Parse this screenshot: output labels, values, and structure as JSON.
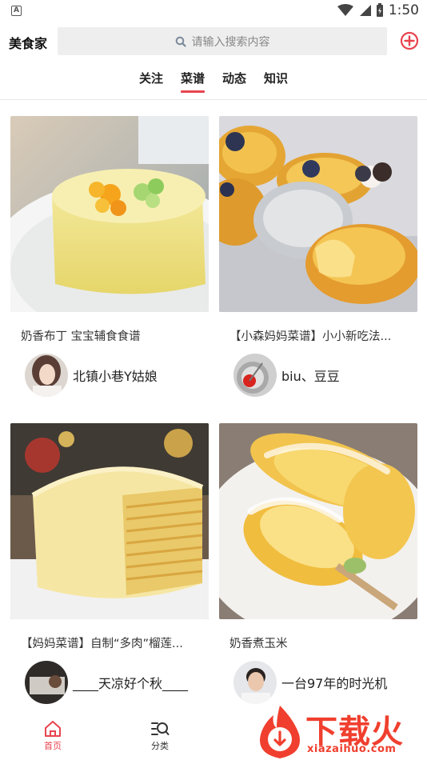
{
  "status_bar": {
    "time": "1:50",
    "badge": "A"
  },
  "header": {
    "app_name": "美食家",
    "search_placeholder": "请输入搜索内容"
  },
  "tabs": [
    {
      "label": "关注",
      "active": false
    },
    {
      "label": "菜谱",
      "active": true
    },
    {
      "label": "动态",
      "active": false
    },
    {
      "label": "知识",
      "active": false
    }
  ],
  "cards": [
    {
      "title": "奶香布丁 宝宝辅食食谱",
      "author": "北镇小巷Y姑娘"
    },
    {
      "title": "【小森妈妈菜谱】小小新吃法...",
      "author": "biu、豆豆"
    },
    {
      "title": "【妈妈菜谱】自制“多肉”榴莲...",
      "author": "____天凉好个秋____"
    },
    {
      "title": "奶香煮玉米",
      "author": "一台97年的时光机"
    }
  ],
  "bottom_nav": [
    {
      "label": "首页",
      "icon": "home-icon",
      "active": true
    },
    {
      "label": "分类",
      "icon": "category-search-icon",
      "active": false
    }
  ],
  "watermark": {
    "text": "下载火",
    "url": "xiazaihuo.com"
  },
  "colors": {
    "accent": "#e8444f",
    "watermark": "#f03f2e",
    "search_bg": "#eeeeee"
  }
}
